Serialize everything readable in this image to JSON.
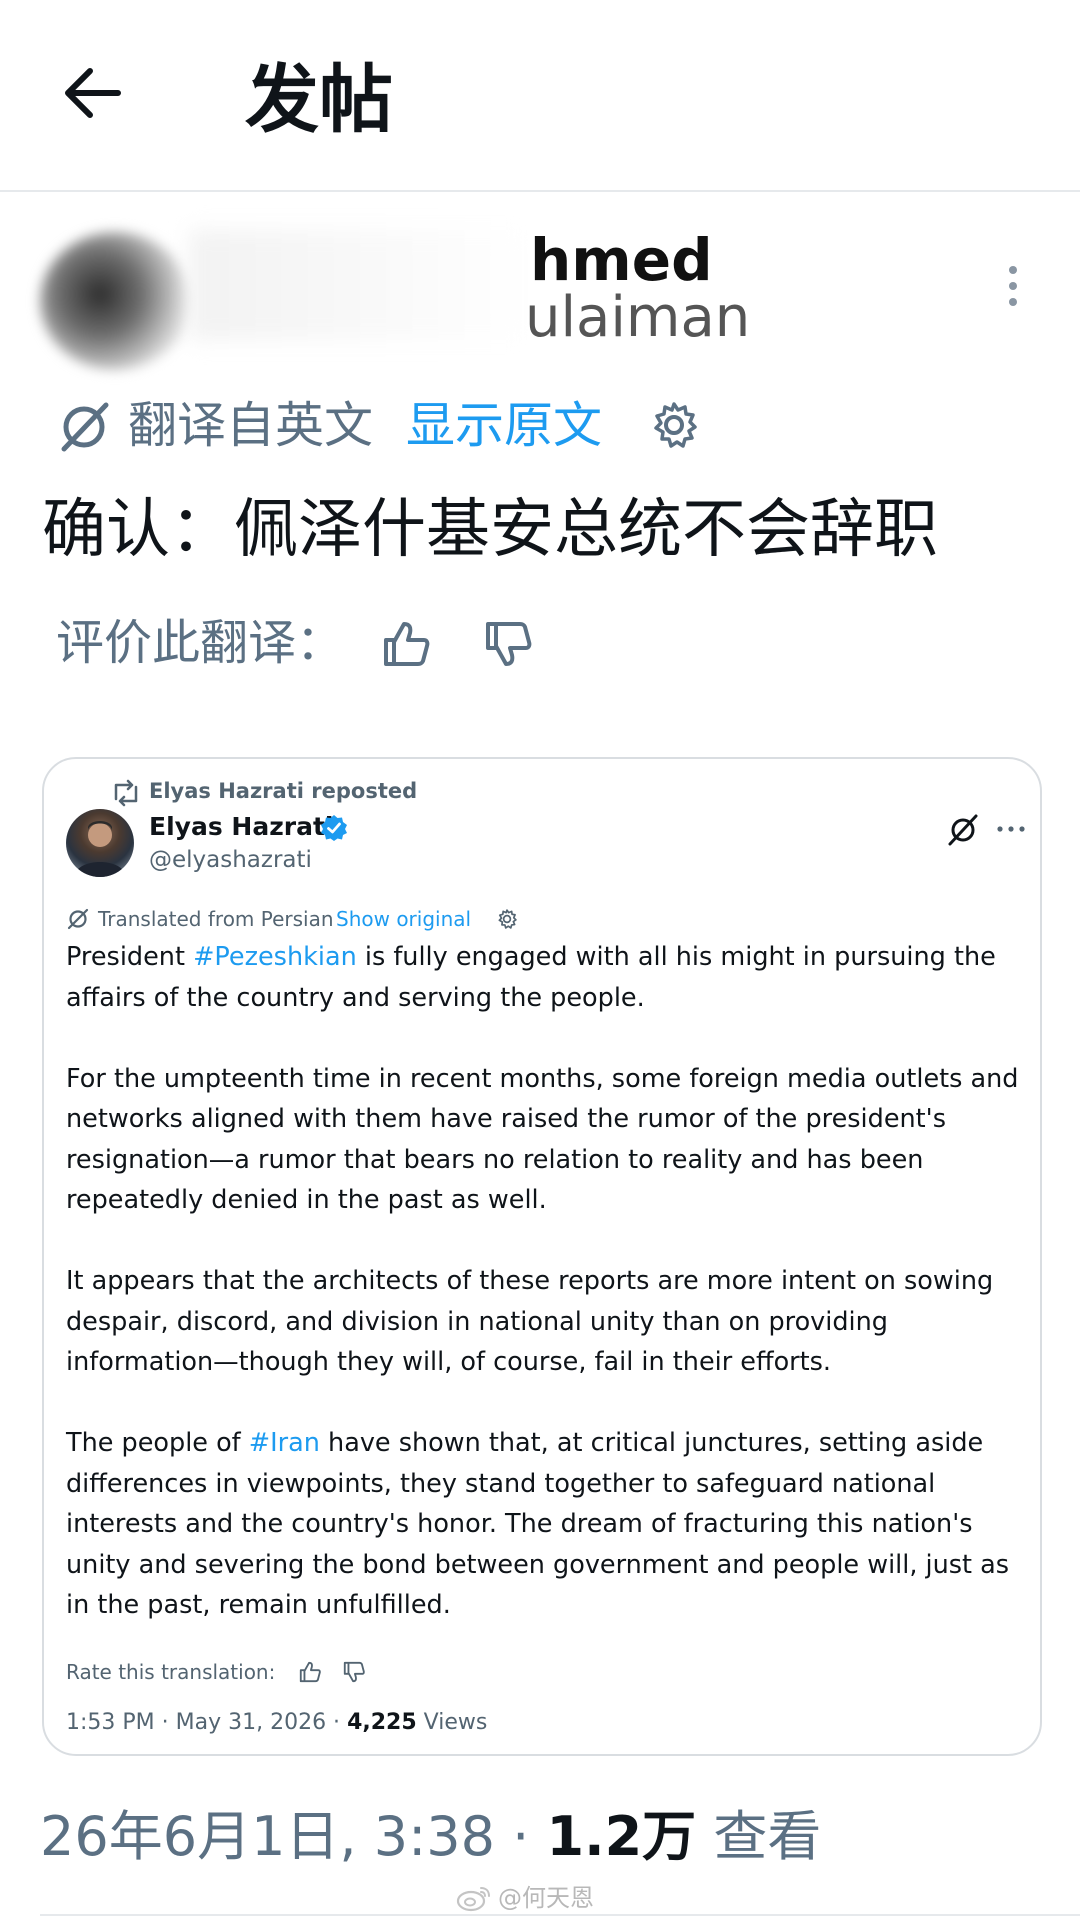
{
  "header": {
    "title": "发帖"
  },
  "author": {
    "name_visible": "hmed",
    "handle_visible": "ulaiman"
  },
  "translation": {
    "from_label": "翻译自英文",
    "show_original": "显示原文"
  },
  "tweet": {
    "text": "确认：佩泽什基安总统不会辞职",
    "rate_label": "评价此翻译："
  },
  "quoted": {
    "repost_label": "Elyas Hazrati reposted",
    "name": "Elyas Hazrati",
    "handle": "@elyashazrati",
    "translated_from": "Translated from Persian",
    "show_original": "Show original",
    "paragraphs": [
      {
        "pre": "President ",
        "tag": "#Pezeshkian",
        "post": " is fully engaged with all his might in pursuing the affairs of the country and serving the people."
      },
      {
        "pre": "For the umpteenth time in recent months, some foreign media outlets and networks aligned with them have raised the rumor of the president's resignation—a rumor that bears no relation to reality and has been repeatedly denied in the past as well.",
        "tag": "",
        "post": ""
      },
      {
        "pre": "It appears that the architects of these reports are more intent on sowing despair, discord, and division in national unity than on providing information—though they will, of course, fail in their efforts.",
        "tag": "",
        "post": ""
      },
      {
        "pre": "The people of ",
        "tag": "#Iran",
        "post": " have shown that, at critical junctures, setting aside differences in viewpoints, they stand together to safeguard national interests and the country's honor. The dream of fracturing this nation's unity and severing the bond between government and people will, just as in the past, remain unfulfilled."
      }
    ],
    "rate_label": "Rate this translation:",
    "time": "1:53 PM · May 31, 2026 · ",
    "views_count": "4,225",
    "views_label": " Views"
  },
  "meta": {
    "datetime": "26年6月1日, 3:38 · ",
    "views_count": "1.2万",
    "views_label": " 查看"
  },
  "watermark": {
    "text": "@何天恩"
  },
  "colors": {
    "accent": "#1d9bf0",
    "muted": "#5b7083",
    "text": "#0f1419"
  }
}
